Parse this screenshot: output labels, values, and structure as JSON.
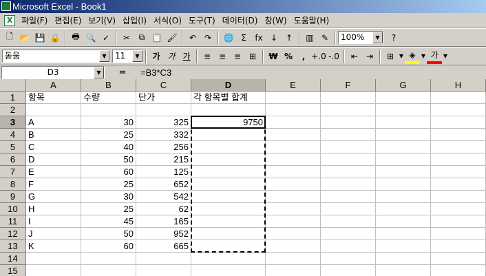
{
  "window": {
    "title": "Microsoft Excel - Book1"
  },
  "menu": [
    "파일(F)",
    "편집(E)",
    "보기(V)",
    "삽입(I)",
    "서식(O)",
    "도구(T)",
    "데이터(D)",
    "창(W)",
    "도움말(H)"
  ],
  "toolbar1": {
    "icons": [
      "new-icon",
      "open-icon",
      "save-icon",
      "permission-icon",
      "print-icon",
      "print-preview-icon",
      "spelling-icon",
      "cut-icon",
      "copy-icon",
      "paste-icon",
      "format-painter-icon",
      "undo-icon",
      "redo-icon",
      "hyperlink-icon",
      "autosum-icon",
      "function-icon",
      "sort-ascending-icon",
      "sort-descending-icon",
      "chart-wizard-icon",
      "drawing-icon",
      "help-icon"
    ],
    "glyphs": [
      "🗋",
      "📂",
      "💾",
      "🔒",
      "🖶",
      "🔍",
      "✓",
      "✂",
      "⧉",
      "📋",
      "🖌",
      "↶",
      "↷",
      "🌐",
      "Σ",
      "fx",
      "↓",
      "↑",
      "▥",
      "✎",
      "?"
    ],
    "zoom": "100%"
  },
  "toolbar2": {
    "font": "돋움",
    "font_size": "11",
    "bold": "가",
    "italic": "가",
    "underline": "가",
    "currency": "₩",
    "percent": "%",
    "comma": ",",
    "font_color_label": "가"
  },
  "formula_bar": {
    "name_box": "D3",
    "equals": "=",
    "formula": "=B3*C3"
  },
  "columns": [
    "A",
    "B",
    "C",
    "D",
    "E",
    "F",
    "G",
    "H"
  ],
  "rows": [
    "1",
    "2",
    "3",
    "4",
    "5",
    "6",
    "7",
    "8",
    "9",
    "10",
    "11",
    "12",
    "13",
    "14",
    "15"
  ],
  "colors": {
    "title_start": "#0a246a",
    "title_end": "#a6caf0",
    "header_bg": "#d4d0c8"
  },
  "cells": {
    "headers": [
      "항목",
      "수량",
      "단가",
      "각 항목별 합계"
    ],
    "data": [
      [
        "A",
        "30",
        "325",
        "9750"
      ],
      [
        "B",
        "25",
        "332",
        ""
      ],
      [
        "C",
        "40",
        "256",
        ""
      ],
      [
        "D",
        "50",
        "215",
        ""
      ],
      [
        "E",
        "60",
        "125",
        ""
      ],
      [
        "F",
        "25",
        "652",
        ""
      ],
      [
        "G",
        "30",
        "542",
        ""
      ],
      [
        "H",
        "25",
        "62",
        ""
      ],
      [
        "I",
        "45",
        "165",
        ""
      ],
      [
        "J",
        "50",
        "952",
        ""
      ],
      [
        "K",
        "60",
        "665",
        ""
      ]
    ]
  }
}
